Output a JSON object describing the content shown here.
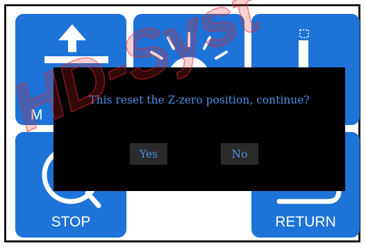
{
  "tiles": {
    "raise": {
      "label": "M",
      "icon": "arrow-up-icon"
    },
    "light": {
      "icon": "light-icon"
    },
    "measure": {
      "icon": "probe-icon"
    },
    "stop": {
      "label": "STOP",
      "icon": "stop-icon"
    },
    "return": {
      "label": "RETURN",
      "icon": "return-icon"
    }
  },
  "dialog": {
    "message": "This reset the Z-zero position, continue?",
    "yes_label": "Yes",
    "no_label": "No"
  },
  "watermark": {
    "text": "HD-Syst"
  },
  "colors": {
    "tile": "#1e73d8",
    "dialog_text": "#4d8fe6",
    "dialog_bg": "#000000",
    "watermark": "#e3262b"
  }
}
